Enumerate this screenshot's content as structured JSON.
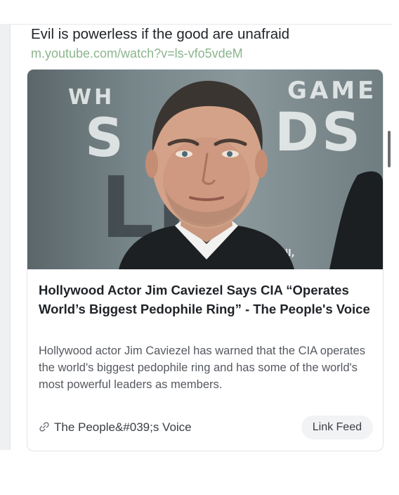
{
  "post": {
    "text": "Evil is powerless if the good are unafraid",
    "link_url": "m.youtube.com/watch?v=ls-vfo5vdeM"
  },
  "card": {
    "image": {
      "bg_text_top_left": "WH",
      "bg_text_top_right": "GAME",
      "bg_text_mid_left": "S",
      "bg_text_mid_right": "DS",
      "bg_text_bottom": "Ll",
      "bg_caption": "nd you fail,"
    },
    "title": "Hollywood Actor Jim Caviezel Says CIA “Operates World’s Biggest Pedophile Ring” - The People's Voice",
    "description": "Hollywood actor Jim Caviezel has warned that the CIA operates the world's biggest pedophile ring and has some of the world's most powerful leaders as members.",
    "source_label": "The People&#039;s Voice",
    "source_icon": "link-icon",
    "action_label": "Link Feed"
  },
  "colors": {
    "link_green": "#8cb58e",
    "text_dark": "#1f2328",
    "text_muted": "#55595f"
  }
}
